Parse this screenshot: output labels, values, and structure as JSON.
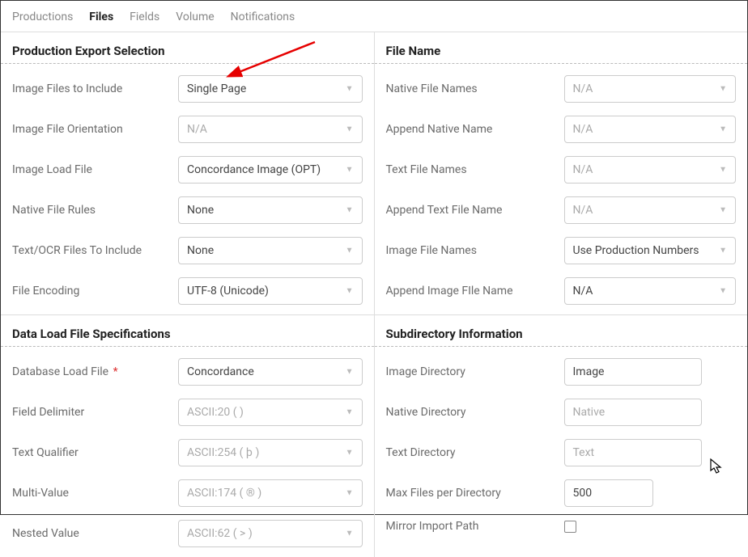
{
  "tabs": {
    "productions": "Productions",
    "files": "Files",
    "fields": "Fields",
    "volume": "Volume",
    "notifications": "Notifications"
  },
  "left": {
    "sec1": {
      "title": "Production Export Selection",
      "imageFilesInclude": {
        "label": "Image Files to Include",
        "value": "Single Page"
      },
      "imageOrientation": {
        "label": "Image File Orientation",
        "value": "N/A"
      },
      "imageLoadFile": {
        "label": "Image Load File",
        "value": "Concordance Image (OPT)"
      },
      "nativeFileRules": {
        "label": "Native File Rules",
        "value": "None"
      },
      "textOcrInclude": {
        "label": "Text/OCR Files To Include",
        "value": "None"
      },
      "fileEncoding": {
        "label": "File Encoding",
        "value": "UTF-8 (Unicode)"
      }
    },
    "sec2": {
      "title": "Data Load File Specifications",
      "databaseLoadFile": {
        "label": "Database Load File",
        "value": "Concordance"
      },
      "fieldDelimiter": {
        "label": "Field Delimiter",
        "value": "ASCII:20 (    )"
      },
      "textQualifier": {
        "label": "Text Qualifier",
        "value": "ASCII:254 ( þ )"
      },
      "multiValue": {
        "label": "Multi-Value",
        "value": "ASCII:174 ( ® )"
      },
      "nestedValue": {
        "label": "Nested Value",
        "value": "ASCII:62 ( > )"
      }
    }
  },
  "right": {
    "sec1": {
      "title": "File Name",
      "nativeFileNames": {
        "label": "Native File Names",
        "value": "N/A"
      },
      "appendNativeName": {
        "label": "Append Native Name",
        "value": "N/A"
      },
      "textFileNames": {
        "label": "Text File Names",
        "value": "N/A"
      },
      "appendTextFileName": {
        "label": "Append Text File Name",
        "value": "N/A"
      },
      "imageFileNames": {
        "label": "Image File Names",
        "value": "Use Production Numbers"
      },
      "appendImageFileName": {
        "label": "Append Image FIle Name",
        "value": "N/A"
      }
    },
    "sec2": {
      "title": "Subdirectory Information",
      "imageDirectory": {
        "label": "Image Directory",
        "value": "Image"
      },
      "nativeDirectory": {
        "label": "Native Directory",
        "value": "Native"
      },
      "textDirectory": {
        "label": "Text Directory",
        "value": "Text"
      },
      "maxFiles": {
        "label": "Max Files per Directory",
        "value": "500"
      },
      "mirrorImport": {
        "label": "Mirror Import Path"
      }
    }
  }
}
